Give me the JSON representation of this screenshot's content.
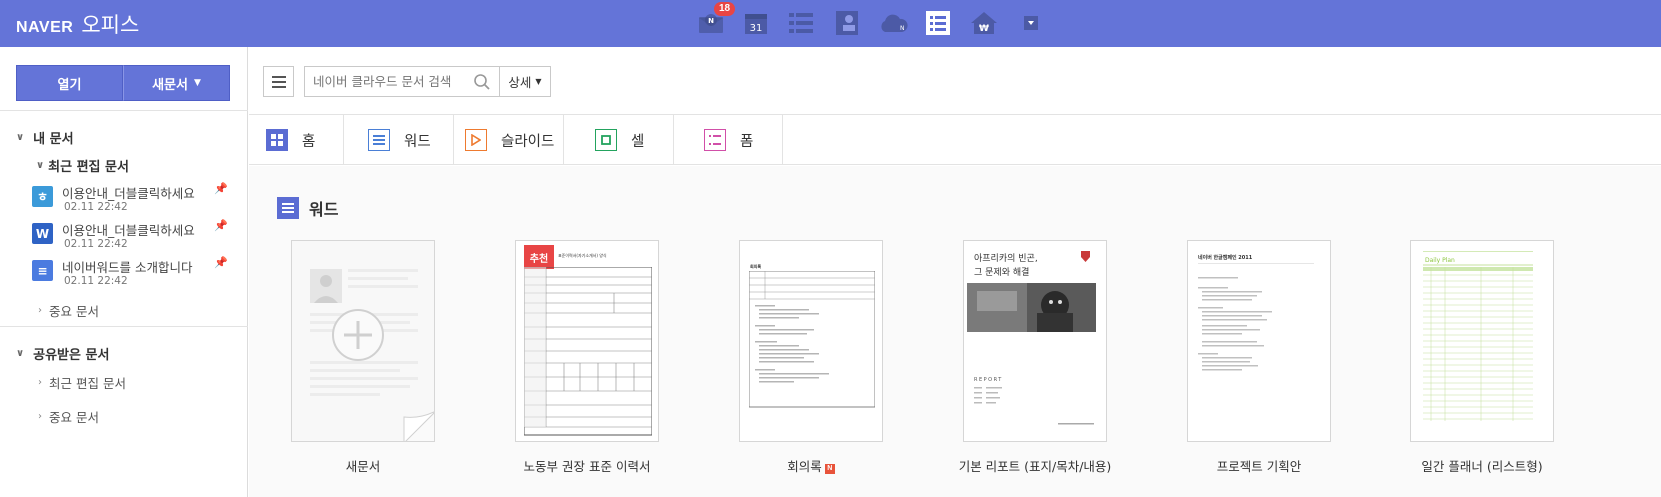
{
  "header": {
    "logo_brand": "NAVER",
    "logo_product": "오피스",
    "mail_badge": "18",
    "calendar_day": "31",
    "apps": [
      "mail-icon",
      "calendar-icon",
      "list-icon",
      "contacts-icon",
      "cloud-icon",
      "office-icon",
      "money-icon",
      "more-dropdown-icon"
    ]
  },
  "sidebar": {
    "open_label": "열기",
    "new_doc_label": "새문서",
    "my_docs": "내 문서",
    "recent_edited": "최근 편집 문서",
    "docs": [
      {
        "icon": "ㅎ",
        "title": "이용안내_더블클릭하세요",
        "date": "02.11 22:42",
        "color": "#3b9ad9"
      },
      {
        "icon": "W",
        "title": "이용안내_더블클릭하세요",
        "date": "02.11 22:42",
        "color": "#2f63c5"
      },
      {
        "icon": "≡",
        "title": "네이버워드를 소개합니다",
        "date": "02.11 22:42",
        "color": "#4b7be0"
      }
    ],
    "important_docs": "중요 문서",
    "shared_docs": "공유받은 문서",
    "shared_recent": "최근 편집 문서",
    "shared_important": "중요 문서"
  },
  "toolbar": {
    "search_placeholder": "네이버 클라우드 문서 검색",
    "detail_label": "상세"
  },
  "tabs": [
    {
      "label": "홈",
      "color": "#5b6cd3"
    },
    {
      "label": "워드",
      "color": "#4a7fd6"
    },
    {
      "label": "슬라이드",
      "color": "#ee7a2f"
    },
    {
      "label": "셀",
      "color": "#23a35e"
    },
    {
      "label": "폼",
      "color": "#d14fa8"
    }
  ],
  "section": {
    "title": "워드"
  },
  "templates": [
    {
      "label": "새문서"
    },
    {
      "label": "노동부 권장 표준 이력서",
      "ribbon": "추천",
      "doc_title": "표준이력서(자기소개서) 양식"
    },
    {
      "label": "회의록",
      "new_badge": "N",
      "doc_title": "회의록"
    },
    {
      "label": "기본 리포트 (표지/목차/내용)",
      "cover_title_1": "아프리카의 빈곤,",
      "cover_title_2": "그 문제와 해결",
      "cover_report": "REPORT"
    },
    {
      "label": "프로젝트 기획안",
      "doc_title": "네이버 한글캠페인 2011"
    },
    {
      "label": "일간 플래너 (리스트형)",
      "doc_title": "Daily Plan"
    }
  ]
}
